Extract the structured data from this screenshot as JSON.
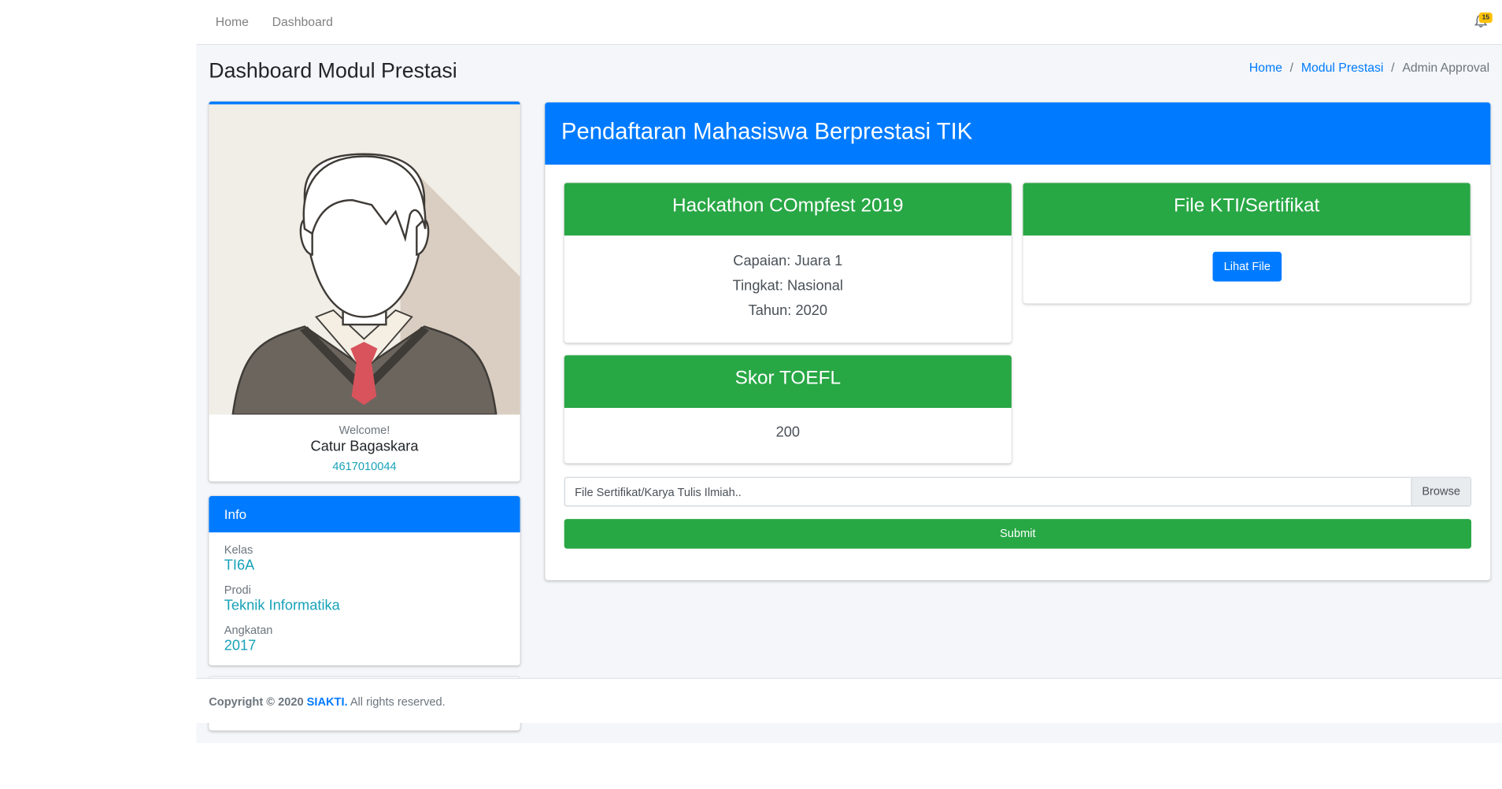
{
  "navbar": {
    "links": [
      "Home",
      "Dashboard"
    ],
    "notification_count": "15"
  },
  "header": {
    "title": "Dashboard Modul Prestasi",
    "breadcrumb": [
      "Home",
      "Modul Prestasi",
      "Admin Approval"
    ],
    "breadcrumb_separator": "/"
  },
  "profile": {
    "welcome": "Welcome!",
    "name": "Catur Bagaskara",
    "nim": "4617010044"
  },
  "info": {
    "title": "Info",
    "items": [
      {
        "label": "Kelas",
        "value": "TI6A"
      },
      {
        "label": "Prodi",
        "value": "Teknik Informatika"
      },
      {
        "label": "Angkatan",
        "value": "2017"
      }
    ]
  },
  "main": {
    "title": "Pendaftaran Mahasiswa Berprestasi TIK",
    "achievement": {
      "title": "Hackathon COmpfest 2019",
      "lines": [
        "Capaian: Juara 1",
        "Tingkat: Nasional",
        "Tahun: 2020"
      ]
    },
    "file_card": {
      "title": "File KTI/Sertifikat",
      "button": "Lihat File"
    },
    "toefl": {
      "title": "Skor TOEFL",
      "score": "200"
    },
    "upload": {
      "placeholder": "File Sertifikat/Karya Tulis Ilmiah..",
      "browse": "Browse"
    },
    "submit": "Submit"
  },
  "footer": {
    "prefix": "Copyright © 2020",
    "brand": "SIAKTI.",
    "suffix": "All rights reserved."
  },
  "colors": {
    "primary": "#007bff",
    "success": "#28a745",
    "info": "#17a2b8",
    "warning": "#ffc107"
  }
}
